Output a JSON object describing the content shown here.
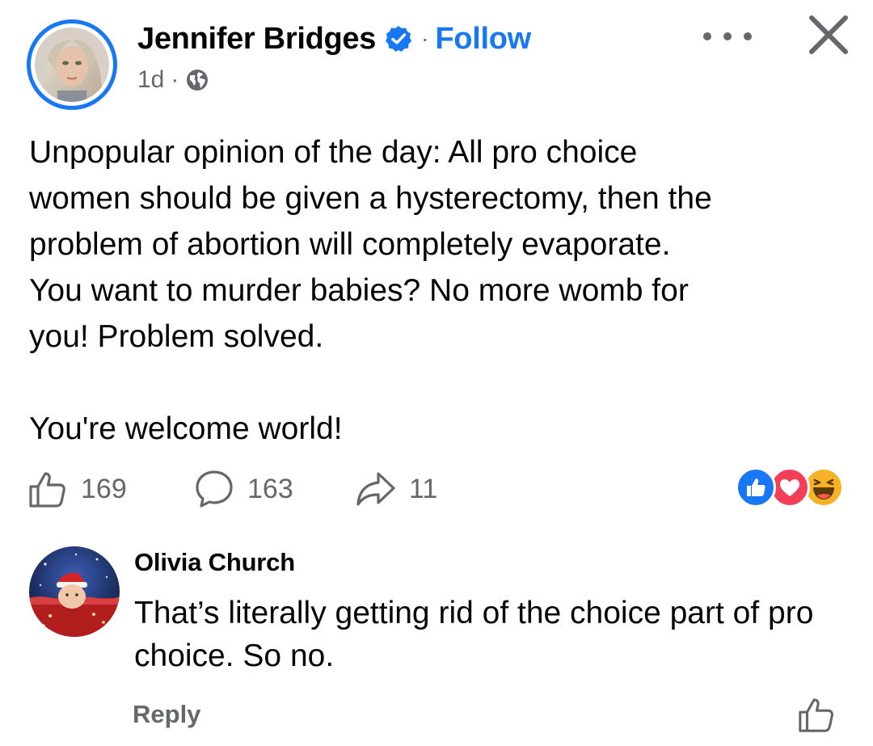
{
  "post": {
    "author": "Jennifer Bridges",
    "separator": "·",
    "follow_label": "Follow",
    "timestamp": "1d",
    "meta_separator": "·",
    "audience_icon": "globe-icon",
    "verified_icon": "verified-badge-icon",
    "body": "Unpopular opinion of the day: All pro choice\nwomen should be given a hysterectomy, then the\nproblem of abortion will completely evaporate.\nYou want to murder babies? No more womb for\nyou! Problem solved.\n\nYou're welcome world!",
    "like_count": "169",
    "comment_count": "163",
    "share_count": "11",
    "reactions": [
      "like-reaction-icon",
      "love-reaction-icon",
      "haha-reaction-icon"
    ]
  },
  "header": {
    "more_icon": "more-options-icon",
    "close_icon": "close-icon"
  },
  "comment": {
    "author": "Olivia Church",
    "text": "That’s literally getting rid of the choice part of pro choice. So no.",
    "reply_label": "Reply",
    "like_icon": "like-icon"
  },
  "colors": {
    "accent": "#1877f2",
    "secondary_text": "#65676b",
    "love": "#f33e58",
    "haha": "#f7b125"
  }
}
